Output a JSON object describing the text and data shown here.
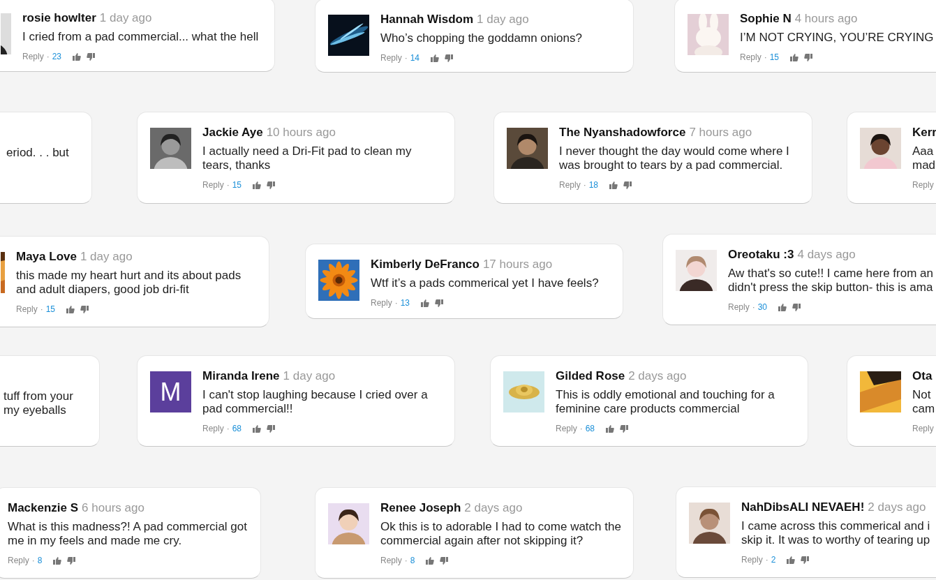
{
  "comments": [
    {
      "avatar": {
        "kind": "picture"
      },
      "name": "rosie howlter",
      "time": "1 day ago",
      "text_lines": [
        "I cried from a pad commercial... what the hell"
      ],
      "reply": "Reply",
      "separator": "·",
      "likes": "23"
    },
    {
      "avatar": {
        "kind": "picture"
      },
      "name": "Hannah Wisdom",
      "time": "1 day ago",
      "text_lines": [
        "Who’s chopping the goddamn onions?"
      ],
      "reply": "Reply",
      "separator": "·",
      "likes": "14"
    },
    {
      "avatar": {
        "kind": "picture"
      },
      "name": "Sophie N",
      "time": "4 hours ago",
      "text_lines": [
        "I’M NOT CRYING, YOU’RE CRYING"
      ],
      "reply": "Reply",
      "separator": "·",
      "likes": "15"
    },
    {
      "text_lines": [
        "eriod. . . but"
      ]
    },
    {
      "avatar": {
        "kind": "picture"
      },
      "name": "Jackie Aye",
      "time": "10 hours ago",
      "text_lines": [
        "I actually need a Dri-Fit pad to clean my",
        "tears, thanks"
      ],
      "reply": "Reply",
      "separator": "·",
      "likes": "15"
    },
    {
      "avatar": {
        "kind": "picture"
      },
      "name": "The Nyanshadowforce",
      "time": "7 hours ago",
      "text_lines": [
        "I never thought the day would come where I",
        "was brought to tears by a pad commercial."
      ],
      "reply": "Reply",
      "separator": "·",
      "likes": "18"
    },
    {
      "avatar": {
        "kind": "picture"
      },
      "name": "Kerr",
      "text_lines": [
        "Aaa",
        "mad"
      ],
      "reply": "Reply"
    },
    {
      "avatar": {
        "kind": "picture"
      },
      "name": "Maya Love",
      "time": "1 day ago",
      "text_lines": [
        "this made my heart hurt and its about pads",
        "and adult diapers, good job dri-fit"
      ],
      "reply": "Reply",
      "separator": "·",
      "likes": "15"
    },
    {
      "avatar": {
        "kind": "picture"
      },
      "name": "Kimberly DeFranco",
      "time": "17 hours ago",
      "text_lines": [
        "Wtf it’s a pads commerical yet I have feels?"
      ],
      "reply": "Reply",
      "separator": "·",
      "likes": "13"
    },
    {
      "avatar": {
        "kind": "picture"
      },
      "name": "Oreotaku :3",
      "time": "4 days ago",
      "text_lines": [
        "Aw that's so cute!! I came here from an",
        "didn't press the skip button- this is ama"
      ],
      "reply": "Reply",
      "separator": "·",
      "likes": "30"
    },
    {
      "text_lines": [
        "tuff from your",
        "my eyeballs"
      ]
    },
    {
      "avatar": {
        "kind": "letter",
        "letter": "M"
      },
      "name": "Miranda Irene",
      "time": "1 day ago",
      "text_lines": [
        "I can't stop laughing because I cried over a",
        "pad commercial!!"
      ],
      "reply": "Reply",
      "separator": "·",
      "likes": "68"
    },
    {
      "avatar": {
        "kind": "picture"
      },
      "name": "Gilded Rose",
      "time": "2 days ago",
      "text_lines": [
        "This is oddly emotional and touching for a",
        "feminine care products commercial"
      ],
      "reply": "Reply",
      "separator": "·",
      "likes": "68"
    },
    {
      "avatar": {
        "kind": "picture"
      },
      "name": "Ota",
      "text_lines": [
        "Not",
        "cam"
      ],
      "reply": "Reply"
    },
    {
      "name": "Mackenzie S",
      "time": "6 hours ago",
      "text_lines": [
        "What is this madness?! A pad commercial got",
        "me in my feels and made me cry."
      ],
      "reply": "Reply",
      "separator": "·",
      "likes": "8"
    },
    {
      "avatar": {
        "kind": "picture"
      },
      "name": "Renee Joseph",
      "time": "2 days ago",
      "text_lines": [
        "Ok this is to adorable I had to come watch the",
        "commercial again after not skipping it?"
      ],
      "reply": "Reply",
      "separator": "·",
      "likes": "8"
    },
    {
      "avatar": {
        "kind": "picture"
      },
      "name": "NahDibsALI NEVAEH!",
      "time": "2 days ago",
      "text_lines": [
        "I came across this commerical and i",
        "skip it. It was to worthy of tearing up"
      ],
      "reply": "Reply",
      "separator": "·",
      "likes": "2"
    }
  ]
}
